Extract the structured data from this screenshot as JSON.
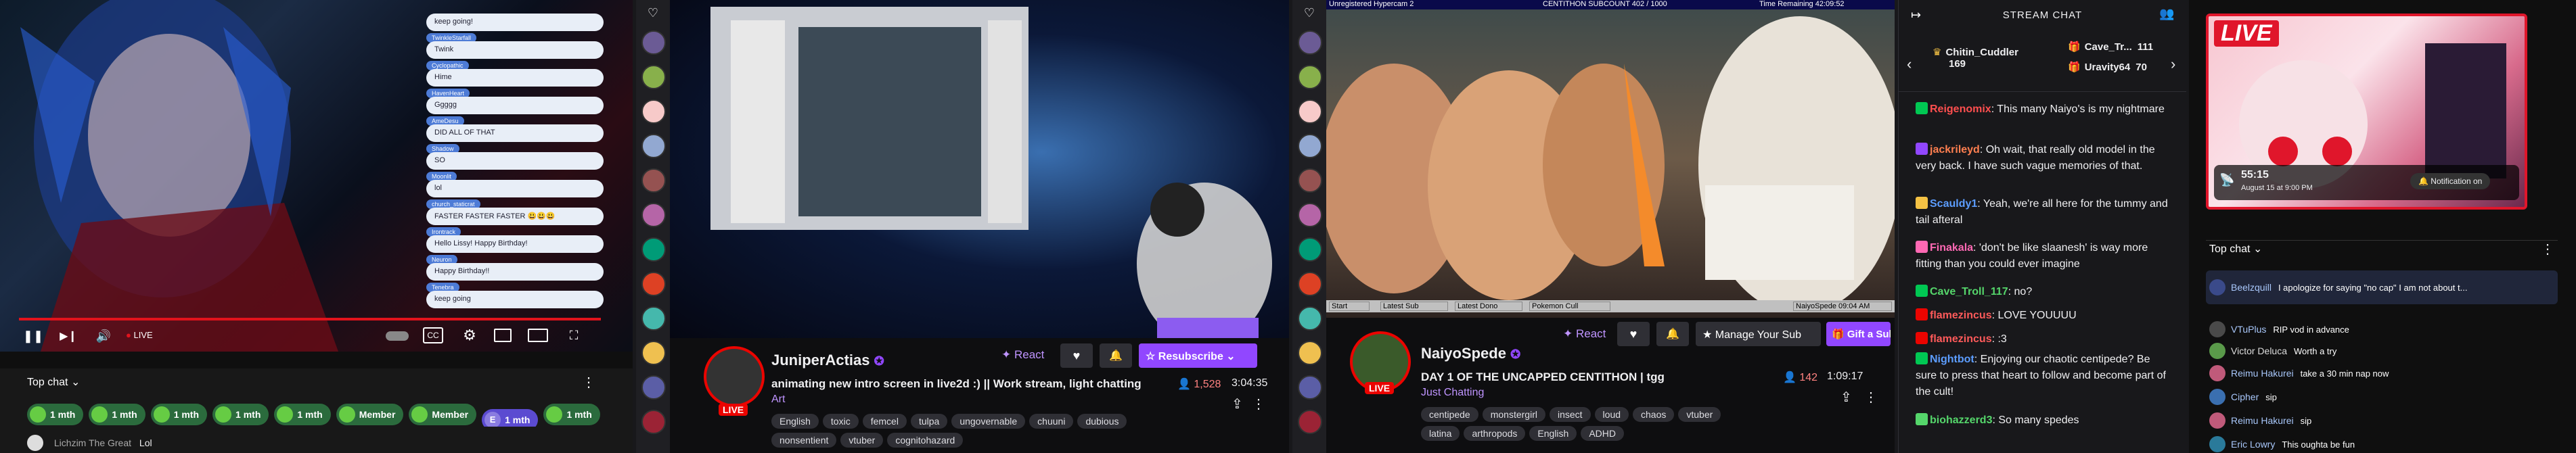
{
  "youtube": {
    "overlay_chat": [
      {
        "name": "",
        "msg": "keep going!"
      },
      {
        "name": "TwinkleStarfall",
        "msg": "Twink"
      },
      {
        "name": "Cyclopathic",
        "msg": "Hime"
      },
      {
        "name": "HavenHeart",
        "msg": "Ggggg"
      },
      {
        "name": "AmeDesu",
        "msg": "DID ALL OF THAT"
      },
      {
        "name": "Shadow",
        "msg": "SO"
      },
      {
        "name": "Moonlit",
        "msg": "lol"
      },
      {
        "name": "church_staticrat",
        "msg": "FASTER FASTER FASTER 😃😃😃"
      },
      {
        "name": "Irontrack",
        "msg": "Hello Lissy! Happy Birthday!"
      },
      {
        "name": "Neuron",
        "msg": "Happy Birthday!!"
      },
      {
        "name": "Tenebra",
        "msg": "keep going"
      }
    ],
    "live_label": "LIVE",
    "chat_title": "Top chat",
    "chips": [
      "1 mth",
      "1 mth",
      "1 mth",
      "1 mth",
      "1 mth",
      "Member",
      "Member",
      "1 mth",
      "1 mth"
    ],
    "chip_initial": "E",
    "last_msg": {
      "name": "Lichzim The Great",
      "msg": "Lol"
    }
  },
  "twitch1": {
    "streamer": "JuniperActias",
    "title": "animating new intro screen in live2d :) || Work stream, light chatting",
    "category": "Art",
    "viewers": "1,528",
    "uptime": "3:04:35",
    "live": "LIVE",
    "react": "React",
    "resub": "Resubscribe",
    "tags": [
      "English",
      "toxic",
      "femcel",
      "tulpa",
      "ungovernable",
      "chuuni",
      "dubious",
      "nonsentient",
      "vtuber",
      "cognitohazard"
    ]
  },
  "twitch2": {
    "top_bar_left": "Unregistered Hypercam 2",
    "top_bar_center": "CENTITHON SUBCOUNT 402 / 1000",
    "top_bar_right": "Time Remaining 42:09:52",
    "taskbar": [
      "Start",
      "Latest Sub",
      "Latest Dono",
      "Pokemon Cull",
      "NaiyoSpede 09:04 AM"
    ],
    "streamer": "NaiyoSpede",
    "title": "DAY 1 OF THE UNCAPPED CENTITHON | tgg",
    "category": "Just Chatting",
    "viewers": "142",
    "uptime": "1:09:17",
    "live": "LIVE",
    "react": "React",
    "manage": "Manage Your Sub",
    "gift": "Gift a Sub",
    "tags": [
      "centipede",
      "monstergirl",
      "insect",
      "loud",
      "chaos",
      "vtuber",
      "latina",
      "arthropods",
      "English",
      "ADHD"
    ]
  },
  "stream_chat": {
    "title": "STREAM CHAT",
    "leaderboard": [
      {
        "name": "Chitin_Cuddler",
        "value": "169"
      },
      {
        "name": "Cave_Tr...",
        "value": "111"
      },
      {
        "name": "Uravity64",
        "value": "70"
      }
    ],
    "messages": [
      {
        "user": "Reigenomix",
        "color": "#ff4f4f",
        "text": "This many Naiyo's is my nightmare"
      },
      {
        "user": "jackrileyd",
        "color": "#ff7f50",
        "text": "Oh wait, that really old model in the very back. I have such vague memories of that."
      },
      {
        "user": "Scauldy1",
        "color": "#5c9dff",
        "text": "Yeah, we're all here for the tummy and tail afteral"
      },
      {
        "user": "Finakala",
        "color": "#ff69b4",
        "text": "'don't be like slaanesh' is way more fitting than you could ever imagine"
      },
      {
        "user": "Cave_Troll_117",
        "color": "#55d66b",
        "text": "no?"
      },
      {
        "user": "flamezincus",
        "color": "#ff5a5a",
        "text": "LOVE YOUUUU"
      },
      {
        "user": "flamezincus",
        "color": "#ff5a5a",
        "text": ":3"
      },
      {
        "user": "Nightbot",
        "color": "#5c9dff",
        "text": "Enjoying our chaotic centipede? Be sure to press that heart to follow and become part of the cult!"
      },
      {
        "user": "biohazzerd3",
        "color": "#55d66b",
        "text": "So many spedes"
      }
    ]
  },
  "panel5": {
    "live": "LIVE",
    "time": "55:15",
    "date": "August 15 at 9:00 PM",
    "notify": "Notification on",
    "chat_title": "Top chat",
    "messages": [
      {
        "name": "Beelzquill",
        "text": "I apologize for saying \"no cap\" I am not about t..."
      },
      {
        "name": "VTuPlus",
        "text": "RIP vod in advance"
      },
      {
        "name": "Victor Deluca",
        "text": "Worth a try"
      },
      {
        "name": "Reimu Hakurei",
        "text": "take a 30 min nap now"
      },
      {
        "name": "Cipher",
        "text": "sip"
      },
      {
        "name": "Reimu Hakurei",
        "text": "sip"
      },
      {
        "name": "Eric Lowry",
        "text": "This oughta be fun"
      }
    ]
  },
  "colors": {
    "twitch_purple": "#9147ff",
    "live_red": "#eb0400",
    "yt_member_green": "#2b6b3d"
  }
}
